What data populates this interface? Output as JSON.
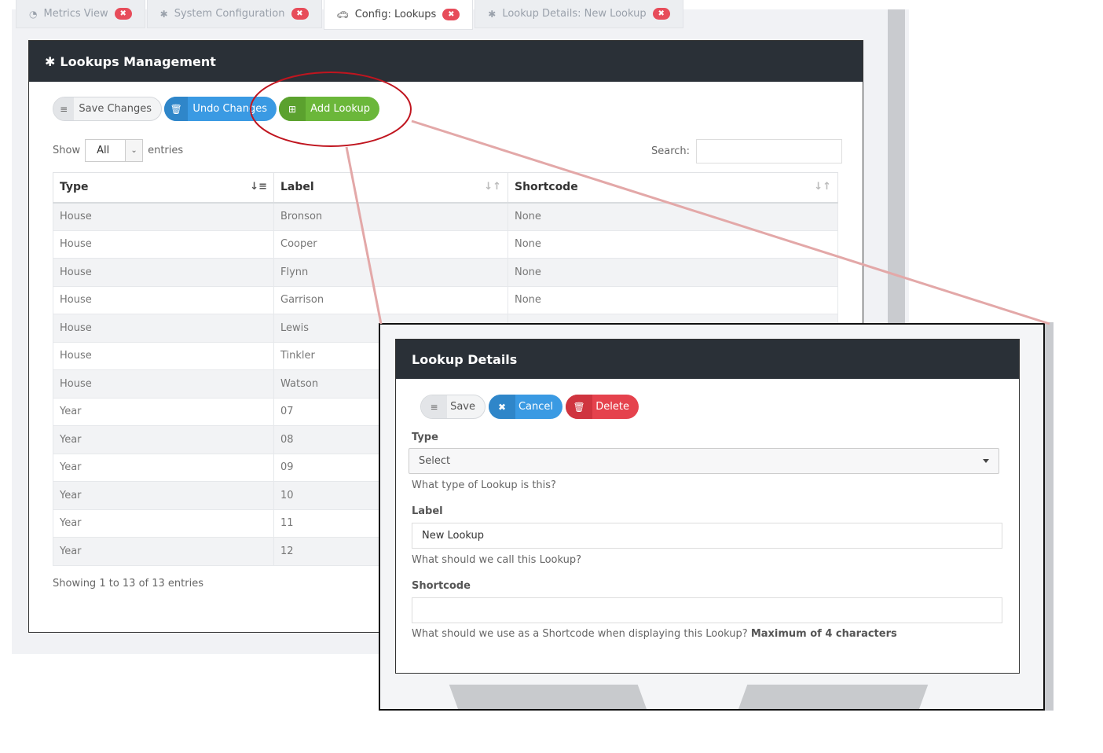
{
  "tabs": [
    {
      "icon": "dashboard-icon",
      "label": "Metrics View"
    },
    {
      "icon": "gear-icon",
      "label": "System Configuration"
    },
    {
      "icon": "car-icon",
      "label": "Config: Lookups"
    },
    {
      "icon": "gear-icon",
      "label": "Lookup Details: New Lookup"
    }
  ],
  "tab_close": "✖",
  "panel": {
    "title": "Lookups Management",
    "buttons": {
      "save": "Save Changes",
      "undo": "Undo Changes",
      "add": "Add Lookup"
    },
    "show_label": "Show",
    "entries_value": "All",
    "entries_label": "entries",
    "search_label": "Search:"
  },
  "table": {
    "headers": [
      "Type",
      "Label",
      "Shortcode"
    ],
    "rows": [
      [
        "House",
        "Bronson",
        "None"
      ],
      [
        "House",
        "Cooper",
        "None"
      ],
      [
        "House",
        "Flynn",
        "None"
      ],
      [
        "House",
        "Garrison",
        "None"
      ],
      [
        "House",
        "Lewis",
        ""
      ],
      [
        "House",
        "Tinkler",
        ""
      ],
      [
        "House",
        "Watson",
        ""
      ],
      [
        "Year",
        "07",
        ""
      ],
      [
        "Year",
        "08",
        ""
      ],
      [
        "Year",
        "09",
        ""
      ],
      [
        "Year",
        "10",
        ""
      ],
      [
        "Year",
        "11",
        ""
      ],
      [
        "Year",
        "12",
        ""
      ]
    ],
    "info": "Showing 1 to 13 of 13 entries"
  },
  "detail": {
    "title": "Lookup Details",
    "buttons": {
      "save": "Save",
      "cancel": "Cancel",
      "delete": "Delete"
    },
    "type_label": "Type",
    "type_value": "Select",
    "type_help": "What type of Lookup is this?",
    "label_label": "Label",
    "label_value": "New Lookup",
    "label_help": "What should we call this Lookup?",
    "shortcode_label": "Shortcode",
    "shortcode_value": "",
    "shortcode_help": "What should we use as a Shortcode when displaying this Lookup?",
    "shortcode_help_bold": "Maximum of 4 characters"
  },
  "colors": {
    "header_dark": "#2a3037",
    "blue": "#3a9ae3",
    "green": "#6bb73a",
    "red": "#e5424d",
    "annotation": "#c0151f"
  }
}
